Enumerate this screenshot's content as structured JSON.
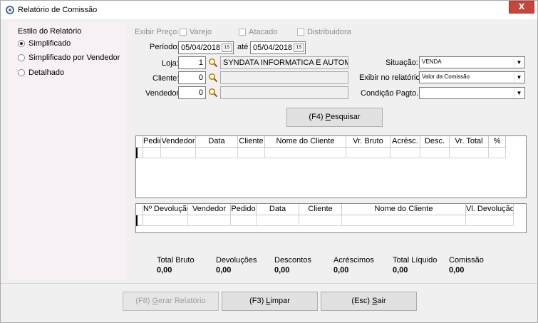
{
  "window": {
    "title": "Relatório de Comissão",
    "close_label": "X"
  },
  "style_panel": {
    "label": "Estilo do Relatório",
    "options": [
      {
        "label": "Simplificado",
        "selected": true
      },
      {
        "label": "Simplificado por Vendedor",
        "selected": false
      },
      {
        "label": "Detalhado",
        "selected": false
      }
    ]
  },
  "filters": {
    "exibir_preco_label": "Exibir Preço:",
    "price_options": [
      {
        "label": "Varejo",
        "checked": false
      },
      {
        "label": "Atacado",
        "checked": false
      },
      {
        "label": "Distribuidora",
        "checked": false
      }
    ],
    "periodo_label": "Período:",
    "date_from": "05/04/2018",
    "ate_label": "até",
    "date_to": "05/04/2018",
    "date_btn": "15",
    "loja_label": "Loja:",
    "loja_code": "1",
    "loja_name": "SYNDATA INFORMATICA E AUTOMAÇ",
    "cliente_label": "Cliente:",
    "cliente_code": "0",
    "cliente_name": "",
    "vendedor_label": "Vendedor:",
    "vendedor_code": "0",
    "vendedor_name": "",
    "situacao_label": "Situação:",
    "situacao_value": "VENDA",
    "exibir_label": "Exibir no relatório:",
    "exibir_value": "Valor da Comissão",
    "condicao_label": "Condição Pagto.:",
    "condicao_value": ""
  },
  "buttons": {
    "pesquisar_prefix": "(F4) ",
    "pesquisar_underline": "P",
    "pesquisar_rest": "esquisar",
    "gerar_prefix": "(F8) ",
    "gerar_underline": "G",
    "gerar_rest": "erar Relatório",
    "limpar_prefix": "(F3) ",
    "limpar_underline": "L",
    "limpar_rest": "impar",
    "sair_prefix": "(Esc) ",
    "sair_underline": "S",
    "sair_rest": "air"
  },
  "sales_grid": {
    "columns": [
      "Pedido",
      "Vendedor",
      "Data",
      "Cliente",
      "Nome do Cliente",
      "Vr. Bruto",
      "Acrésc.",
      "Desc.",
      "Vr. Total",
      "%"
    ]
  },
  "returns_grid": {
    "columns": [
      "Nº Devolução",
      "Vendedor",
      "Pedido",
      "Data",
      "Cliente",
      "Nome do Cliente",
      "Vl. Devolução"
    ]
  },
  "totals": [
    {
      "label": "Total Bruto",
      "value": "0,00"
    },
    {
      "label": "Devoluções",
      "value": "0,00"
    },
    {
      "label": "Descontos",
      "value": "0,00"
    },
    {
      "label": "Acréscimos",
      "value": "0,00"
    },
    {
      "label": "Total Líquido",
      "value": "0,00"
    },
    {
      "label": "Comissão",
      "value": "0,00"
    }
  ]
}
